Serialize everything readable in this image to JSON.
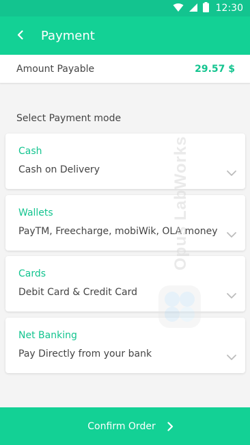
{
  "status_bar": {
    "time": "12:30",
    "icons": [
      "wifi-icon",
      "signal-icon",
      "battery-icon"
    ]
  },
  "app_bar": {
    "title": "Payment",
    "back_icon": "chevron-left-icon"
  },
  "amount": {
    "label": "Amount Payable",
    "value": "29.57 $"
  },
  "payment_section": {
    "label": "Select Payment mode",
    "options": [
      {
        "title": "Cash",
        "description": "Cash on Delivery",
        "icon": "chevron-down-icon"
      },
      {
        "title": "Wallets",
        "description": "PayTM, Freecharge, mobiWik, OLA money",
        "icon": "chevron-down-icon"
      },
      {
        "title": "Cards",
        "description": "Debit Card & Credit Card",
        "icon": "chevron-down-icon"
      },
      {
        "title": "Net Banking",
        "description": "Pay Directly from your bank",
        "icon": "chevron-down-icon"
      }
    ]
  },
  "watermark": {
    "text": "Opus LabWorks"
  },
  "confirm": {
    "label": "Confirm Order",
    "icon": "chevron-right-icon"
  },
  "colors": {
    "accent": "#13d195",
    "accent_text": "#13c48f",
    "background": "#f4f4f4"
  }
}
